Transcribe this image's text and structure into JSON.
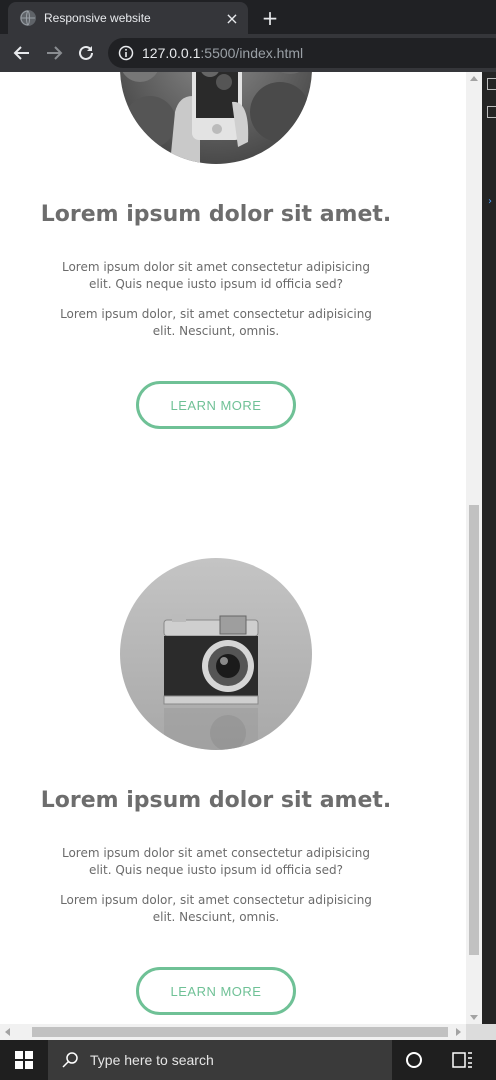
{
  "browser": {
    "tab_title": "Responsive website",
    "tab_close": "×",
    "new_tab": "+",
    "url_host": "127.0.0.1",
    "url_rest": ":5500/index.html"
  },
  "cards": [
    {
      "heading": "Lorem ipsum dolor sit amet.",
      "paragraph1": "Lorem ipsum dolor sit amet consectetur adipisicing elit. Quis neque iusto ipsum id officia sed?",
      "paragraph2": "Lorem ipsum dolor, sit amet consectetur adipisicing elit. Nesciunt, omnis.",
      "button": "LEARN MORE",
      "image": "phone-photo"
    },
    {
      "heading": "Lorem ipsum dolor sit amet.",
      "paragraph1": "Lorem ipsum dolor sit amet consectetur adipisicing elit. Quis neque iusto ipsum id officia sed?",
      "paragraph2": "Lorem ipsum dolor, sit amet consectetur adipisicing elit. Nesciunt, omnis.",
      "button": "LEARN MORE",
      "image": "camera-photo"
    }
  ],
  "taskbar": {
    "search_placeholder": "Type here to search"
  },
  "colors": {
    "accent": "#6fc196",
    "heading": "#6d6d6d",
    "chrome_bg": "#35363a"
  }
}
